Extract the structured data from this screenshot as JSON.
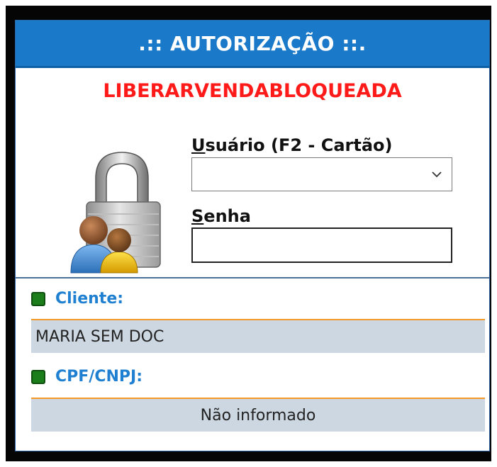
{
  "dialog": {
    "title": ".:: AUTORIZAÇÃO ::.",
    "operation": "LIBERARVENDABLOQUEADA"
  },
  "login": {
    "user_label_key": "U",
    "user_label_rest": "suário (F2 - Cartão)",
    "user_value": "",
    "password_label_key": "S",
    "password_label_rest": "enha",
    "password_value": ""
  },
  "client": {
    "label": "Cliente:",
    "value": "MARIA SEM DOC"
  },
  "document": {
    "label": "CPF/CNPJ:",
    "value": "Não informado"
  },
  "colors": {
    "titlebar": "#1a79c9",
    "operation_text": "#ff1a1a",
    "field_label": "#1f7fd0",
    "status_indicator": "#1b7e1b",
    "value_background": "#cdd7e2",
    "value_border": "#f39a2a"
  },
  "icons": {
    "security": "lock-users-icon",
    "dropdown": "chevron-down-icon",
    "client_status": "green-square-icon",
    "document_status": "green-square-icon"
  }
}
